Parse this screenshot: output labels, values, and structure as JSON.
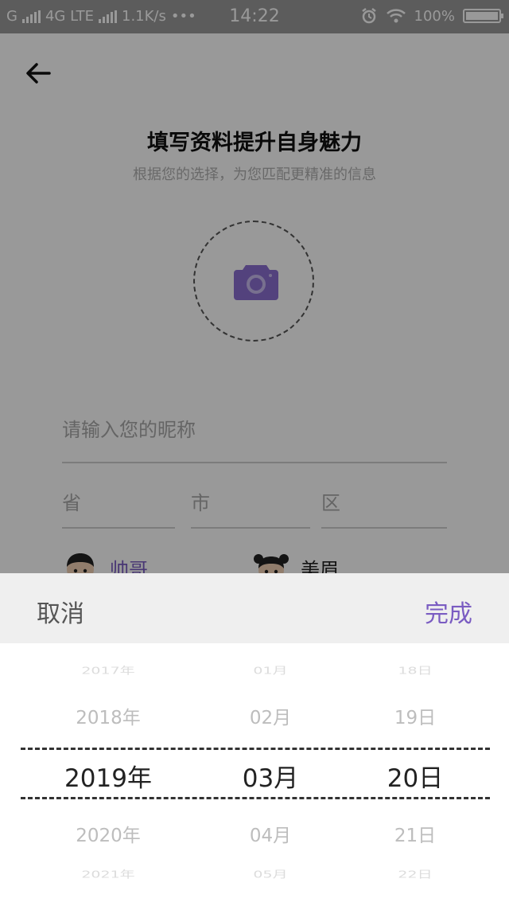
{
  "status_bar": {
    "carrier": "G",
    "network": "4G LTE",
    "speed": "1.1K/s",
    "dots": "•••",
    "time": "14:22",
    "battery": "100%",
    "battery_level": 1.0
  },
  "profile": {
    "title": "填写资料提升自身魅力",
    "subtitle": "根据您的选择，为您匹配更精准的信息",
    "nickname_placeholder": "请输入您的昵称",
    "province_placeholder": "省",
    "city_placeholder": "市",
    "district_placeholder": "区",
    "gender_male": "帅哥",
    "gender_female": "美眉"
  },
  "picker": {
    "cancel_label": "取消",
    "done_label": "完成",
    "years": [
      "2017年",
      "2018年",
      "2019年",
      "2020年",
      "2021年"
    ],
    "months": [
      "01月",
      "02月",
      "03月",
      "04月",
      "05月"
    ],
    "days": [
      "18日",
      "19日",
      "20日",
      "21日",
      "22日"
    ]
  },
  "colors": {
    "accent": "#7a5cc2",
    "camera": "#8a6fd0"
  }
}
